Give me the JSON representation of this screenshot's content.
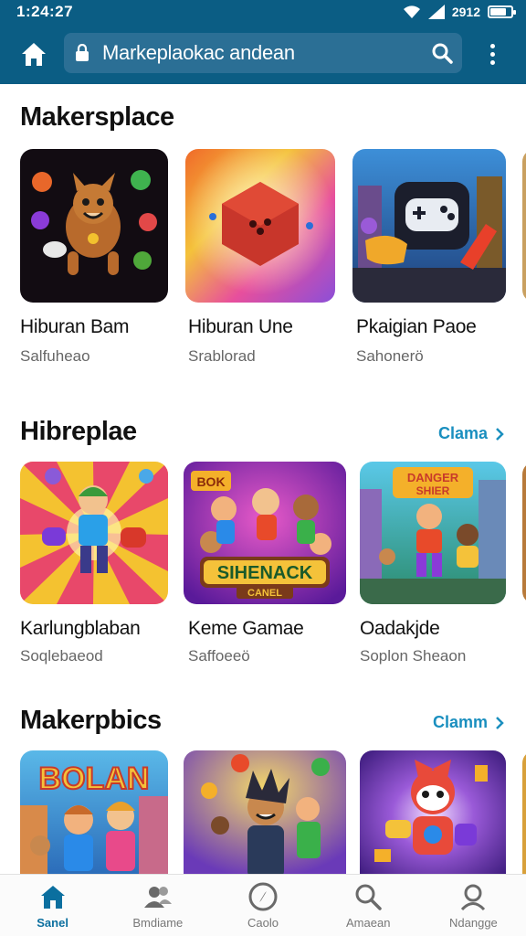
{
  "status_bar": {
    "time": "1:24:27",
    "signal_text": "2912",
    "battery_level": 0.7
  },
  "header": {
    "url": "Markeрlaokac andean"
  },
  "sections": [
    {
      "title": "Makersplace",
      "see_all": "",
      "apps": [
        {
          "name": "Hiburan Bam",
          "sub": "Salfuheao"
        },
        {
          "name": "Hiburan Une",
          "sub": "Srablorad"
        },
        {
          "name": "Pkaigian Paoe",
          "sub": "Sahonerö"
        }
      ]
    },
    {
      "title": "Hibreplae",
      "see_all": "Clama",
      "apps": [
        {
          "name": "Karlungblaban",
          "sub": "Soqlebaeod"
        },
        {
          "name": "Keme Gamae",
          "sub": "Saffoeeö"
        },
        {
          "name": "Oadakjde",
          "sub": "Soplon Sheaon"
        }
      ],
      "tile_texts": [
        "BOK",
        "SIHENACK",
        "CANEL",
        "DANGER",
        "SHIER"
      ]
    },
    {
      "title": "Makerpbics",
      "see_all": "Clamm",
      "apps": [],
      "tile_texts": [
        "BOLAN"
      ]
    }
  ],
  "bottom_nav": [
    {
      "label": "Sanel",
      "icon": "home-icon",
      "active": true
    },
    {
      "label": "Bmdiame",
      "icon": "people-icon",
      "active": false
    },
    {
      "label": "Caolo",
      "icon": "compass-icon",
      "active": false
    },
    {
      "label": "Amaean",
      "icon": "search-icon",
      "active": false
    },
    {
      "label": "Ndangge",
      "icon": "person-icon",
      "active": false
    }
  ],
  "colors": {
    "header": "#0b5d84",
    "accent": "#1a8fbf",
    "active_nav": "#0b6f9f"
  }
}
